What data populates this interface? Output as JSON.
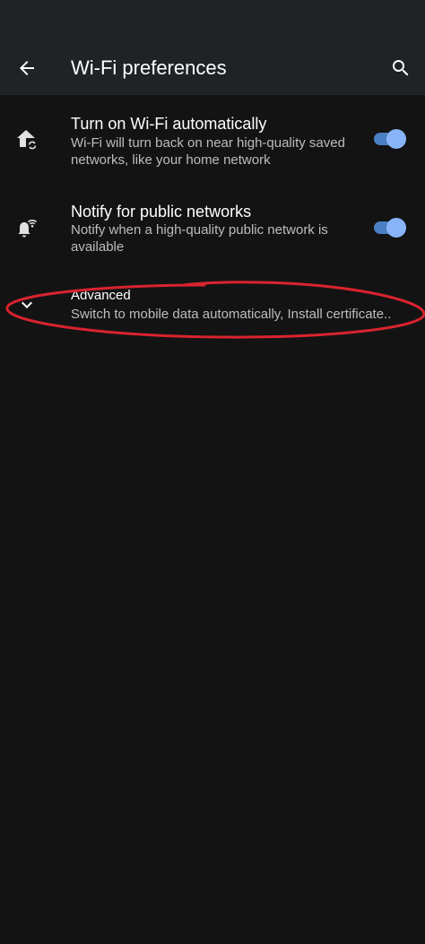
{
  "appbar": {
    "title": "Wi-Fi preferences",
    "back_icon": "arrow-back-icon",
    "search_icon": "search-icon"
  },
  "preferences": [
    {
      "icon": "home-wifi-sync-icon",
      "title": "Turn on Wi-Fi automatically",
      "summary": "Wi-Fi will turn back on near high-quality saved networks, like your home network",
      "toggle_on": true
    },
    {
      "icon": "notification-wifi-icon",
      "title": "Notify for public networks",
      "summary": "Notify when a high-quality public network is available",
      "toggle_on": true
    }
  ],
  "advanced": {
    "icon": "chevron-down-icon",
    "title": "Advanced",
    "summary": "Switch to mobile data automatically, Install certificate.."
  },
  "colors": {
    "background": "#131313",
    "appbar": "#1f2326",
    "switch_thumb": "#8ab4f8",
    "switch_track": "#4b7fc4",
    "annotation_ring": "#d9232e"
  }
}
